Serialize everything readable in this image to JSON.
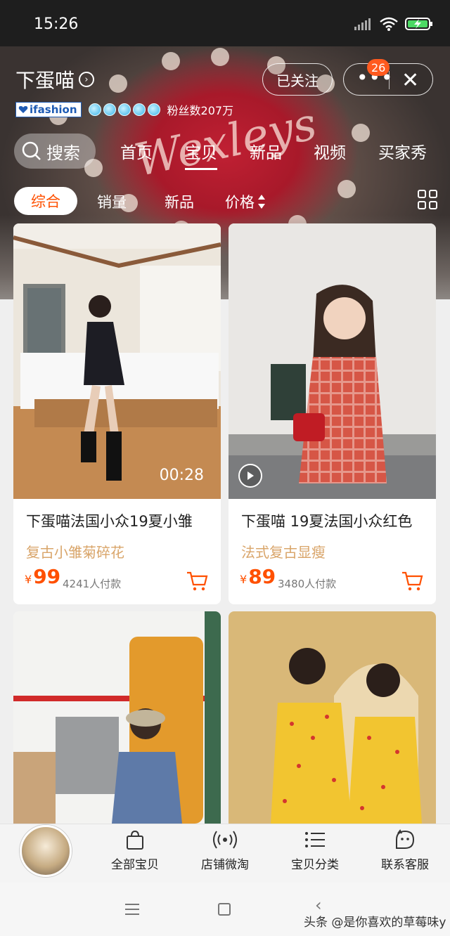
{
  "status_bar": {
    "time": "15:26"
  },
  "header": {
    "shop_name": "下蛋喵",
    "brand_label": "ifashion",
    "fans": "粉丝数207万",
    "follow_label": "已关注",
    "message_badge": "26"
  },
  "nav": {
    "search_label": "搜索",
    "tabs": [
      {
        "label": "首页",
        "active": false
      },
      {
        "label": "宝贝",
        "active": true
      },
      {
        "label": "新品",
        "active": false
      },
      {
        "label": "视频",
        "active": false
      },
      {
        "label": "买家秀",
        "active": false
      }
    ]
  },
  "filters": [
    {
      "label": "综合",
      "active": true
    },
    {
      "label": "销量",
      "active": false
    },
    {
      "label": "新品",
      "active": false
    },
    {
      "label": "价格",
      "active": false
    }
  ],
  "products": [
    {
      "title": "下蛋喵法国小众19夏小雏",
      "subtitle": "复古小雏菊碎花",
      "currency": "¥",
      "price": "99",
      "sold": "4241人付款",
      "duration": "00:28"
    },
    {
      "title": "下蛋喵 19夏法国小众红色",
      "subtitle": "法式复古显瘦",
      "currency": "¥",
      "price": "89",
      "sold": "3480人付款"
    }
  ],
  "tabbar": [
    {
      "label": "全部宝贝",
      "icon": "bag-icon"
    },
    {
      "label": "店铺微淘",
      "icon": "broadcast-icon"
    },
    {
      "label": "宝贝分类",
      "icon": "list-icon"
    },
    {
      "label": "联系客服",
      "icon": "chat-face-icon"
    }
  ],
  "watermark": "头条 @是你喜欢的草莓味y",
  "colors": {
    "accent": "#ff5000",
    "subtitle": "#d9a56a",
    "badge": "#ff5a1f"
  }
}
